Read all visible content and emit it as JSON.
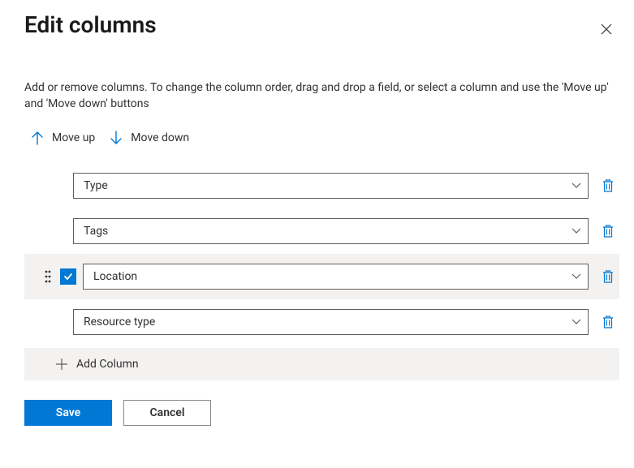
{
  "title": "Edit columns",
  "description": "Add or remove columns. To change the column order, drag and drop a field, or select a column and use the 'Move up' and 'Move down' buttons",
  "toolbar": {
    "move_up": "Move up",
    "move_down": "Move down"
  },
  "columns": [
    {
      "label": "Type",
      "selected": false
    },
    {
      "label": "Tags",
      "selected": false
    },
    {
      "label": "Location",
      "selected": true
    },
    {
      "label": "Resource type",
      "selected": false
    }
  ],
  "add_column_label": "Add Column",
  "footer": {
    "save": "Save",
    "cancel": "Cancel"
  },
  "colors": {
    "accent": "#0078d4"
  }
}
